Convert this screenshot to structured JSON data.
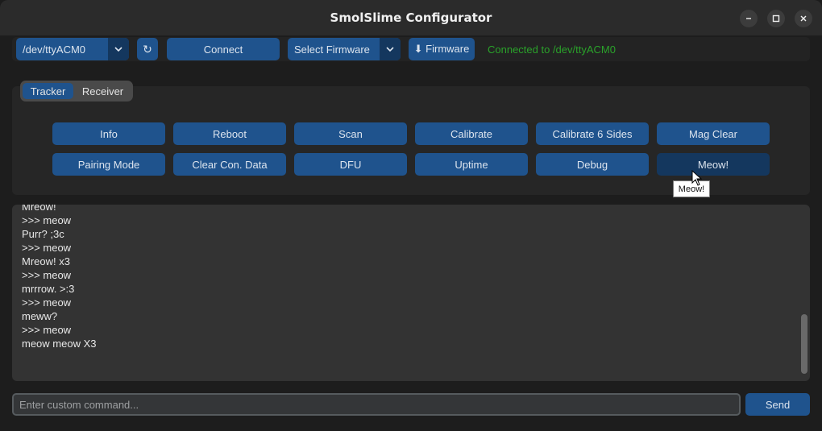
{
  "window": {
    "title": "SmolSlime Configurator",
    "minimize_icon": "minimize-icon",
    "maximize_icon": "maximize-icon",
    "close_icon": "close-icon"
  },
  "toolbar": {
    "port_value": "/dev/ttyACM0",
    "refresh_icon": "refresh-icon",
    "connect_label": "Connect",
    "firmware_select_value": "Select Firmware",
    "firmware_button_label": "⬇ Firmware",
    "status_text": "Connected to /dev/ttyACM0"
  },
  "tabs": [
    {
      "label": "Tracker",
      "active": true
    },
    {
      "label": "Receiver",
      "active": false
    }
  ],
  "commands": {
    "row1": [
      "Info",
      "Reboot",
      "Scan",
      "Calibrate",
      "Calibrate 6 Sides",
      "Mag Clear"
    ],
    "row2": [
      "Pairing Mode",
      "Clear Con. Data",
      "DFU",
      "Uptime",
      "Debug",
      "Meow!"
    ]
  },
  "tooltip": "Meow!",
  "console": {
    "lines": [
      "Mreow!",
      ">>> meow",
      "Purr? ;3c",
      ">>> meow",
      "Mreow! x3",
      ">>> meow",
      "mrrrow. >:3",
      ">>> meow",
      "meww?",
      ">>> meow",
      "meow meow X3"
    ]
  },
  "input": {
    "placeholder": "Enter custom command...",
    "value": ""
  },
  "send_label": "Send",
  "colors": {
    "accent": "#1f538d",
    "accent_dark": "#14375e",
    "status_green": "#2aa22a",
    "background": "#1c1c1c"
  }
}
